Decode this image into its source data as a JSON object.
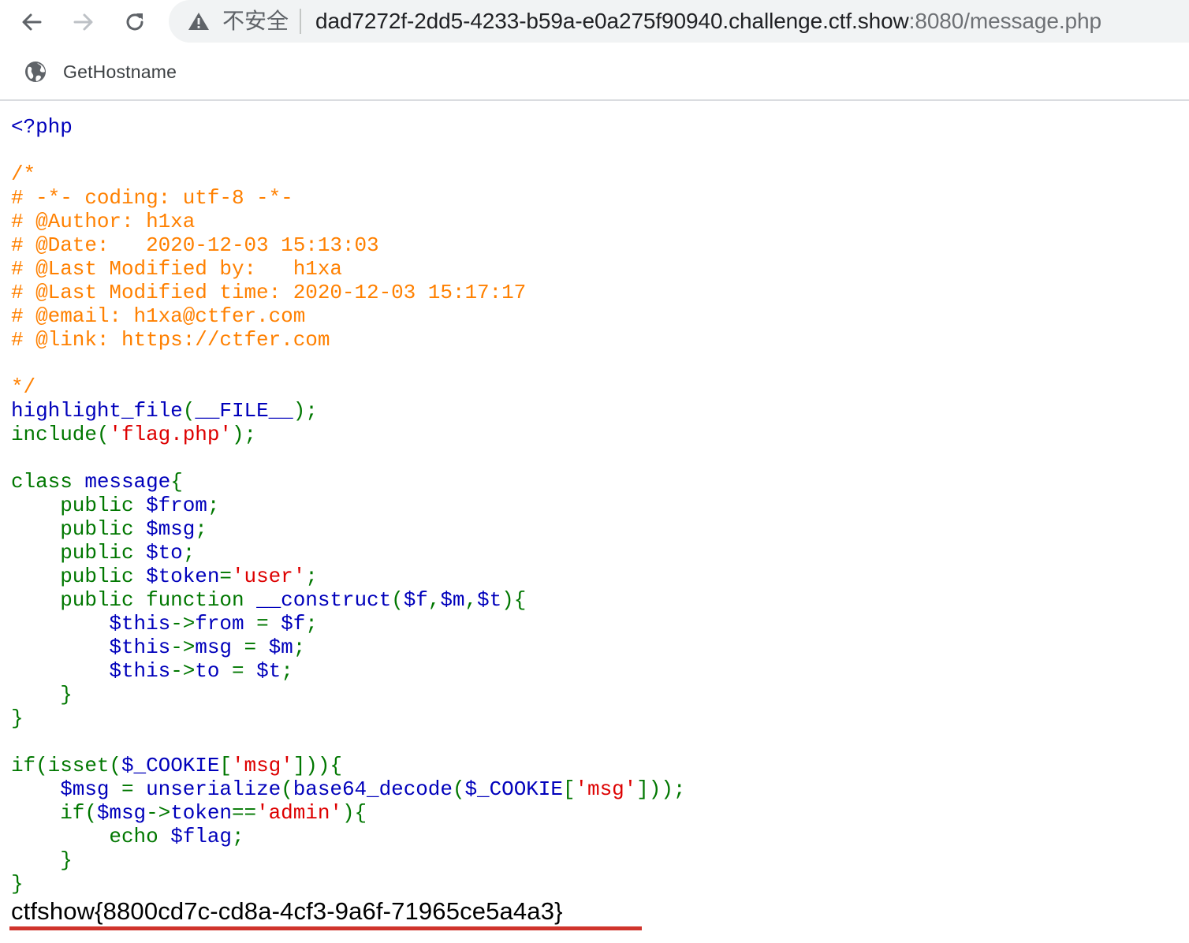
{
  "browser": {
    "security_label": "不安全",
    "url_host": "dad7272f-2dd5-4233-b59a-e0a275f90940.challenge.ctf.show",
    "url_rest": ":8080/message.php",
    "icons": {
      "back": "arrow-left-icon",
      "forward": "arrow-right-icon",
      "reload": "reload-icon",
      "warning": "warning-triangle-icon"
    }
  },
  "bookmarks": [
    {
      "label": "GetHostname",
      "icon": "globe-icon"
    }
  ],
  "colors": {
    "default": "#0000BB",
    "keyword": "#007700",
    "string": "#DD0000",
    "comment": "#FF8000",
    "underline": "#d0342c"
  },
  "code_lines": [
    [
      [
        "def",
        "<?php"
      ]
    ],
    [],
    [
      [
        "cm",
        "/*"
      ]
    ],
    [
      [
        "cm",
        "# -*- coding: utf-8 -*-"
      ]
    ],
    [
      [
        "cm",
        "# @Author: h1xa"
      ]
    ],
    [
      [
        "cm",
        "# @Date:   2020-12-03 15:13:03"
      ]
    ],
    [
      [
        "cm",
        "# @Last Modified by:   h1xa"
      ]
    ],
    [
      [
        "cm",
        "# @Last Modified time: 2020-12-03 15:17:17"
      ]
    ],
    [
      [
        "cm",
        "# @email: h1xa@ctfer.com"
      ]
    ],
    [
      [
        "cm",
        "# @link: https://ctfer.com"
      ]
    ],
    [],
    [
      [
        "cm",
        "*/"
      ]
    ],
    [
      [
        "def",
        "highlight_file"
      ],
      [
        "kw",
        "("
      ],
      [
        "def",
        "__FILE__"
      ],
      [
        "kw",
        ");"
      ]
    ],
    [
      [
        "kw",
        "include("
      ],
      [
        "str",
        "'flag.php'"
      ],
      [
        "kw",
        ");"
      ]
    ],
    [],
    [
      [
        "kw",
        "class "
      ],
      [
        "def",
        "message"
      ],
      [
        "kw",
        "{"
      ]
    ],
    [
      [
        "kw",
        "    public "
      ],
      [
        "def",
        "$from"
      ],
      [
        "kw",
        ";"
      ]
    ],
    [
      [
        "kw",
        "    public "
      ],
      [
        "def",
        "$msg"
      ],
      [
        "kw",
        ";"
      ]
    ],
    [
      [
        "kw",
        "    public "
      ],
      [
        "def",
        "$to"
      ],
      [
        "kw",
        ";"
      ]
    ],
    [
      [
        "kw",
        "    public "
      ],
      [
        "def",
        "$token"
      ],
      [
        "kw",
        "="
      ],
      [
        "str",
        "'user'"
      ],
      [
        "kw",
        ";"
      ]
    ],
    [
      [
        "kw",
        "    public function "
      ],
      [
        "def",
        "__construct"
      ],
      [
        "kw",
        "("
      ],
      [
        "def",
        "$f"
      ],
      [
        "kw",
        ","
      ],
      [
        "def",
        "$m"
      ],
      [
        "kw",
        ","
      ],
      [
        "def",
        "$t"
      ],
      [
        "kw",
        "){"
      ]
    ],
    [
      [
        "kw",
        "        "
      ],
      [
        "def",
        "$this"
      ],
      [
        "kw",
        "->"
      ],
      [
        "def",
        "from "
      ],
      [
        "kw",
        "= "
      ],
      [
        "def",
        "$f"
      ],
      [
        "kw",
        ";"
      ]
    ],
    [
      [
        "kw",
        "        "
      ],
      [
        "def",
        "$this"
      ],
      [
        "kw",
        "->"
      ],
      [
        "def",
        "msg "
      ],
      [
        "kw",
        "= "
      ],
      [
        "def",
        "$m"
      ],
      [
        "kw",
        ";"
      ]
    ],
    [
      [
        "kw",
        "        "
      ],
      [
        "def",
        "$this"
      ],
      [
        "kw",
        "->"
      ],
      [
        "def",
        "to "
      ],
      [
        "kw",
        "= "
      ],
      [
        "def",
        "$t"
      ],
      [
        "kw",
        ";"
      ]
    ],
    [
      [
        "kw",
        "    }"
      ]
    ],
    [
      [
        "kw",
        "}"
      ]
    ],
    [],
    [
      [
        "kw",
        "if(isset("
      ],
      [
        "def",
        "$_COOKIE"
      ],
      [
        "kw",
        "["
      ],
      [
        "str",
        "'msg'"
      ],
      [
        "kw",
        "])){"
      ]
    ],
    [
      [
        "kw",
        "    "
      ],
      [
        "def",
        "$msg "
      ],
      [
        "kw",
        "= "
      ],
      [
        "def",
        "unserialize"
      ],
      [
        "kw",
        "("
      ],
      [
        "def",
        "base64_decode"
      ],
      [
        "kw",
        "("
      ],
      [
        "def",
        "$_COOKIE"
      ],
      [
        "kw",
        "["
      ],
      [
        "str",
        "'msg'"
      ],
      [
        "kw",
        "]));"
      ]
    ],
    [
      [
        "kw",
        "    if("
      ],
      [
        "def",
        "$msg"
      ],
      [
        "kw",
        "->"
      ],
      [
        "def",
        "token"
      ],
      [
        "kw",
        "=="
      ],
      [
        "str",
        "'admin'"
      ],
      [
        "kw",
        "){"
      ]
    ],
    [
      [
        "kw",
        "        echo "
      ],
      [
        "def",
        "$flag"
      ],
      [
        "kw",
        ";"
      ]
    ],
    [
      [
        "kw",
        "    }"
      ]
    ],
    [
      [
        "kw",
        "}"
      ]
    ]
  ],
  "flag_output": "ctfshow{8800cd7c-cd8a-4cf3-9a6f-71965ce5a4a3}"
}
